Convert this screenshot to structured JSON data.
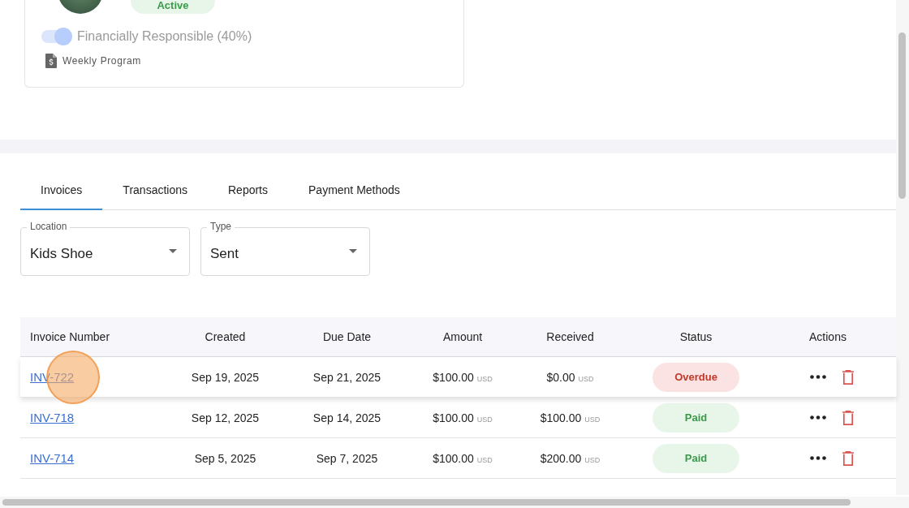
{
  "profile": {
    "status": "Active",
    "financially_responsible": {
      "label": "Financially Responsible (40%)",
      "on": true
    },
    "program": "Weekly Program"
  },
  "tabs": [
    {
      "label": "Invoices",
      "selected": true
    },
    {
      "label": "Transactions",
      "selected": false
    },
    {
      "label": "Reports",
      "selected": false
    },
    {
      "label": "Payment Methods",
      "selected": false
    }
  ],
  "filters": [
    {
      "label": "Location",
      "value": "Kids Shoe"
    },
    {
      "label": "Type",
      "value": "Sent"
    }
  ],
  "table": {
    "columns": [
      "Invoice Number",
      "Created",
      "Due Date",
      "Amount",
      "Received",
      "Status",
      "Actions"
    ],
    "rows": [
      {
        "invoice": "INV-722",
        "created": "Sep 19, 2025",
        "due": "Sep 21, 2025",
        "amount": "$100.00",
        "amount_currency": "USD",
        "received": "$0.00",
        "received_currency": "USD",
        "status": "Overdue",
        "kind": "overdue",
        "hovered": true
      },
      {
        "invoice": "INV-718",
        "created": "Sep 12, 2025",
        "due": "Sep 14, 2025",
        "amount": "$100.00",
        "amount_currency": "USD",
        "received": "$100.00",
        "received_currency": "USD",
        "status": "Paid",
        "kind": "paid",
        "hovered": false
      },
      {
        "invoice": "INV-714",
        "created": "Sep 5, 2025",
        "due": "Sep 7, 2025",
        "amount": "$100.00",
        "amount_currency": "USD",
        "received": "$200.00",
        "received_currency": "USD",
        "status": "Paid",
        "kind": "paid",
        "hovered": false
      }
    ]
  }
}
